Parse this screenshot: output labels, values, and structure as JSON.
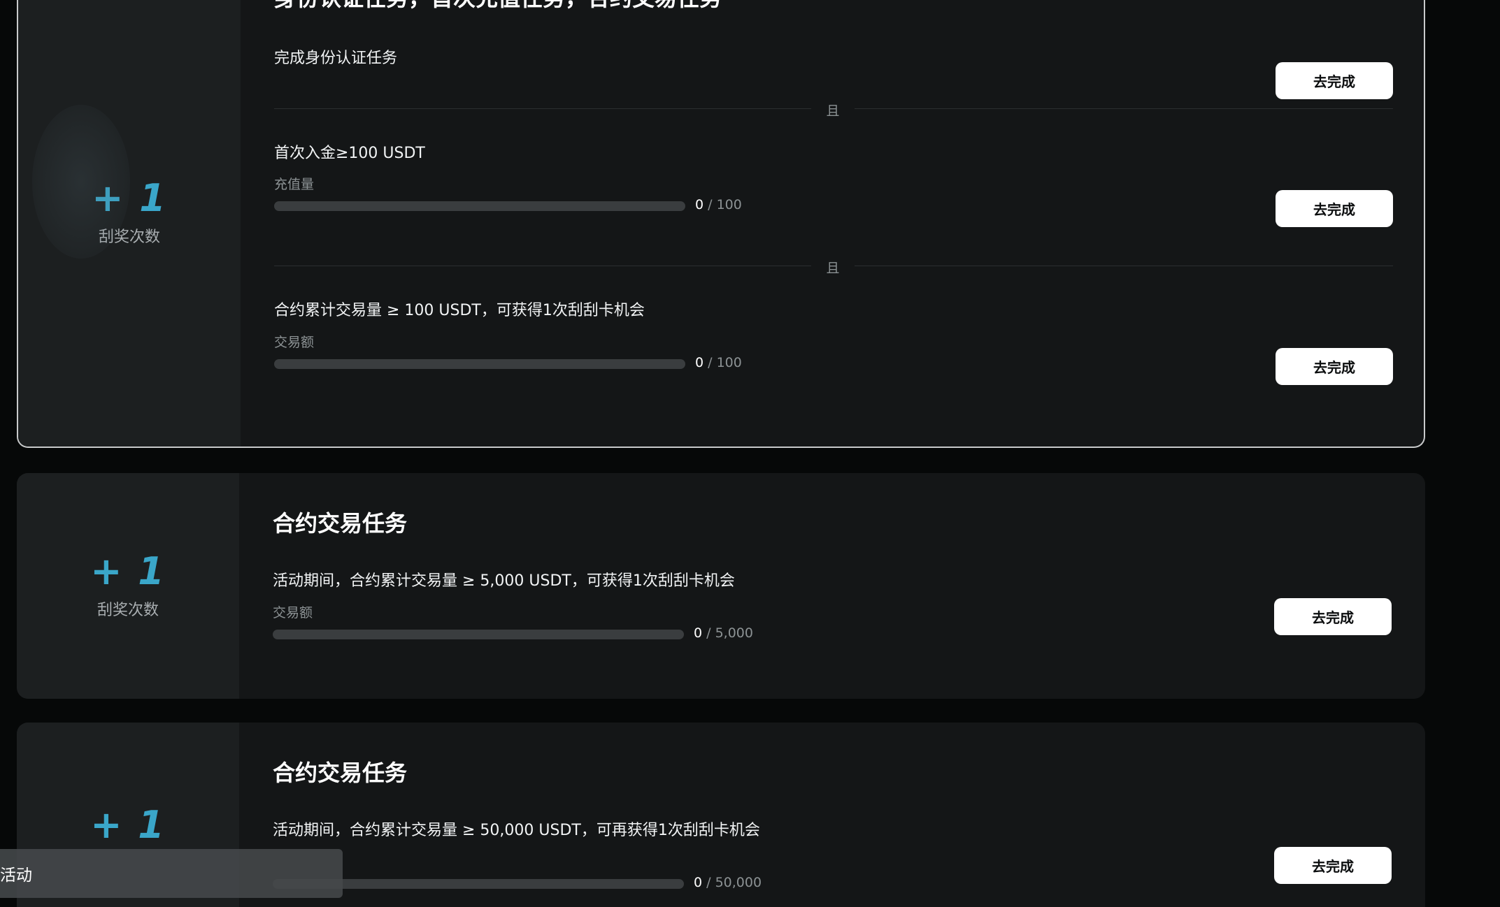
{
  "colors": {
    "accent": "#3aa6c9",
    "card_bg": "#141617",
    "reward_bg": "#1c1f20",
    "button_bg": "#ffffff",
    "bar_track": "#3a3d3f"
  },
  "cards": [
    {
      "reward_count": "+ 1",
      "reward_label": "刮奖次数",
      "title": "身份认证任务，首次充值任务，合约交易任务",
      "connector": "且",
      "tasks": [
        {
          "text": "完成身份认证任务",
          "button": "去完成"
        },
        {
          "text": "首次入金≥100 USDT",
          "metric_label": "充值量",
          "current": "0",
          "total": "/ 100",
          "progress": 0,
          "button": "去完成"
        },
        {
          "text": "合约累计交易量 ≥ 100 USDT，可获得1次刮刮卡机会",
          "metric_label": "交易额",
          "current": "0",
          "total": "/ 100",
          "progress": 0,
          "button": "去完成"
        }
      ]
    },
    {
      "reward_count": "+ 1",
      "reward_label": "刮奖次数",
      "title": "合约交易任务",
      "tasks": [
        {
          "text": "活动期间，合约累计交易量 ≥ 5,000 USDT，可获得1次刮刮卡机会",
          "metric_label": "交易额",
          "current": "0",
          "total": "/ 5,000",
          "progress": 0,
          "button": "去完成"
        }
      ]
    },
    {
      "reward_count": "+ 1",
      "title": "合约交易任务",
      "tasks": [
        {
          "text": "活动期间，合约累计交易量 ≥ 50,000 USDT，可再获得1次刮刮卡机会",
          "current": "0",
          "total": "/ 50,000",
          "progress": 0,
          "button": "去完成"
        }
      ]
    }
  ],
  "toast": {
    "text": "活动"
  }
}
